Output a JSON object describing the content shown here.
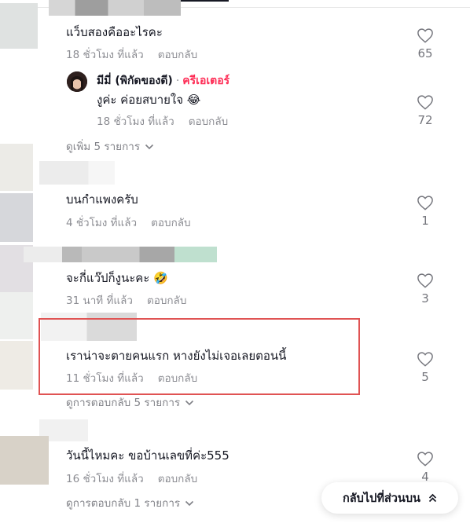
{
  "comments": [
    {
      "text": "แว็บสองคืออะไรคะ",
      "time": "18 ชั่วโมง ที่แล้ว",
      "reply": "ตอบกลับ",
      "likes": "65"
    },
    {
      "text": "บนกำแพงครับ",
      "time": "4 ชั่วโมง ที่แล้ว",
      "reply": "ตอบกลับ",
      "likes": "1"
    },
    {
      "text": "จะกี่แว๊ปก็งูนะคะ 🤣",
      "time": "31 นาที ที่แล้ว",
      "reply": "ตอบกลับ",
      "likes": "3"
    },
    {
      "text": "เราน่าจะตายคนแรก หางยังไม่เจอเลยตอนนี้",
      "time": "11 ชั่วโมง ที่แล้ว",
      "reply": "ตอบกลับ",
      "likes": "5"
    },
    {
      "text": "วันนี้ไหมคะ ขอบ้านเลขที่ค่ะ555",
      "time": "16 ชั่วโมง ที่แล้ว",
      "reply": "ตอบกลับ",
      "likes": "4"
    }
  ],
  "creator_reply": {
    "name": "มีมี่ (พิกัดของดี)",
    "separator": "·",
    "badge": "ครีเอเตอร์",
    "text": "งูค่ะ ค่อยสบายใจ 😂",
    "time": "18 ชั่วโมง ที่แล้ว",
    "reply": "ตอบกลับ",
    "likes": "72"
  },
  "view_more": [
    "ดูเพิ่ม 5 รายการ",
    "ดูการตอบกลับ 5 รายการ",
    "ดูการตอบกลับ 1 รายการ"
  ],
  "back_to_top": "กลับไปที่ส่วนบน",
  "colors": {
    "highlight_border": "#e05353",
    "creator_badge": "#fe2c55"
  }
}
